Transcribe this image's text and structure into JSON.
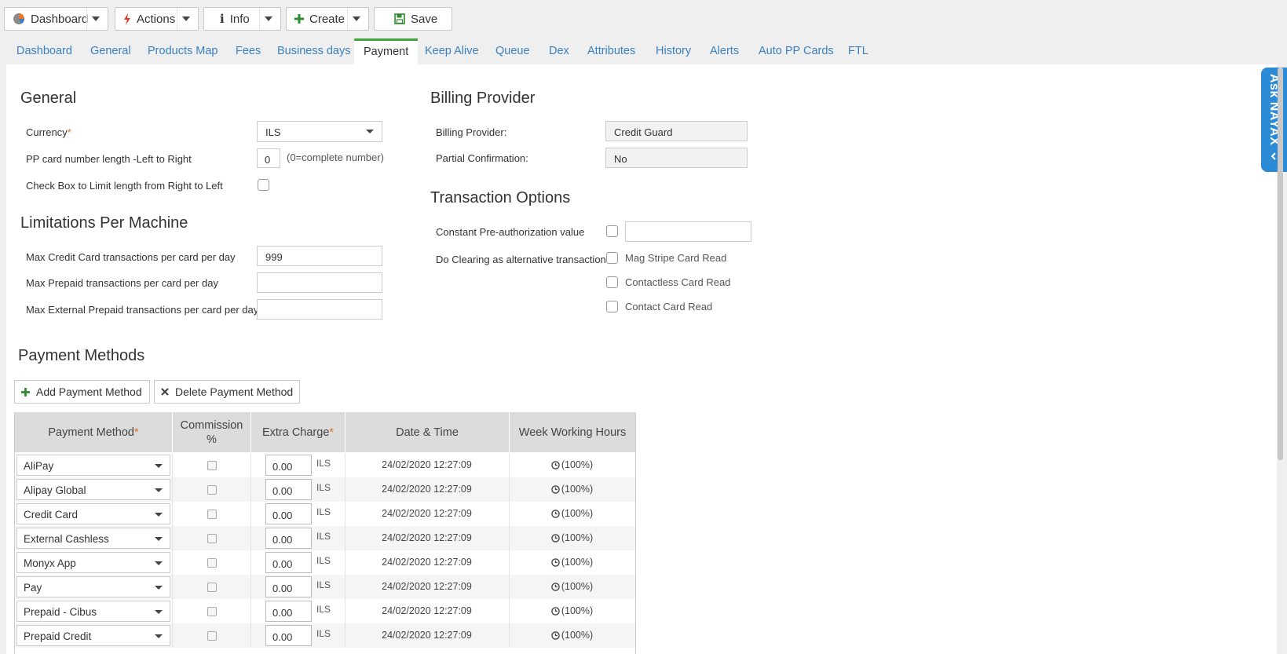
{
  "toolbar": {
    "dashboard": "Dashboard",
    "actions": "Actions",
    "info": "Info",
    "create": "Create",
    "save": "Save"
  },
  "tabs": [
    "Dashboard",
    "General",
    "Products Map",
    "Fees",
    "Business days",
    "Payment",
    "Keep Alive",
    "Queue",
    "Dex",
    "Attributes",
    "History",
    "Alerts",
    "Auto PP Cards",
    "FTL"
  ],
  "active_tab": "Payment",
  "general": {
    "title": "General",
    "currency_label": "Currency",
    "currency_required": "*",
    "currency_value": "ILS",
    "pp_length_label": "PP card number length -Left to Right",
    "pp_length_value": "0",
    "pp_length_hint": "(0=complete number)",
    "limit_rtl_label": "Check Box to Limit length from Right to Left"
  },
  "limitations": {
    "title": "Limitations Per Machine",
    "max_cc_label": "Max Credit Card transactions per card per day",
    "max_cc_value": "999",
    "max_prepaid_label": "Max Prepaid transactions per card per day",
    "max_prepaid_value": "",
    "max_ext_prepaid_label": "Max External Prepaid transactions per card per day",
    "max_ext_prepaid_value": ""
  },
  "billing": {
    "title": "Billing Provider",
    "provider_label": "Billing Provider:",
    "provider_value": "Credit Guard",
    "partial_label": "Partial Confirmation:",
    "partial_value": "No"
  },
  "transaction": {
    "title": "Transaction Options",
    "preauth_label": "Constant Pre-authorization value",
    "preauth_value": "",
    "clearing_label": "Do Clearing as alternative transaction",
    "mag_stripe": "Mag Stripe Card Read",
    "contactless": "Contactless Card Read",
    "contact": "Contact Card Read"
  },
  "payment_methods": {
    "title": "Payment Methods",
    "add_button": "Add Payment Method",
    "delete_button": "Delete Payment Method",
    "columns": {
      "method": "Payment Method",
      "method_required": "*",
      "commission_line1": "Commission",
      "commission_line2": "%",
      "extra_charge": "Extra Charge",
      "extra_required": "*",
      "date_time": "Date & Time",
      "week_hours": "Week Working Hours"
    },
    "rows": [
      {
        "method": "AliPay",
        "extra": "0.00",
        "unit": "ILS",
        "date": "24/02/2020 12:27:09",
        "hours": "(100%)"
      },
      {
        "method": "Alipay Global",
        "extra": "0.00",
        "unit": "ILS",
        "date": "24/02/2020 12:27:09",
        "hours": "(100%)"
      },
      {
        "method": "Credit Card",
        "extra": "0.00",
        "unit": "ILS",
        "date": "24/02/2020 12:27:09",
        "hours": "(100%)"
      },
      {
        "method": "External Cashless",
        "extra": "0.00",
        "unit": "ILS",
        "date": "24/02/2020 12:27:09",
        "hours": "(100%)"
      },
      {
        "method": "Monyx App",
        "extra": "0.00",
        "unit": "ILS",
        "date": "24/02/2020 12:27:09",
        "hours": "(100%)"
      },
      {
        "method": "Pay",
        "extra": "0.00",
        "unit": "ILS",
        "date": "24/02/2020 12:27:09",
        "hours": "(100%)"
      },
      {
        "method": "Prepaid - Cibus",
        "extra": "0.00",
        "unit": "ILS",
        "date": "24/02/2020 12:27:09",
        "hours": "(100%)"
      },
      {
        "method": "Prepaid Credit",
        "extra": "0.00",
        "unit": "ILS",
        "date": "24/02/2020 12:27:09",
        "hours": "(100%)"
      }
    ]
  },
  "ask_nayax": "Ask NAYAX",
  "colors": {
    "link": "#3a81c1",
    "active_tab_border": "#43a63a",
    "required": "#e0712c",
    "ask_panel": "#2b8bd7",
    "grid_header": "#dcdcdc"
  }
}
